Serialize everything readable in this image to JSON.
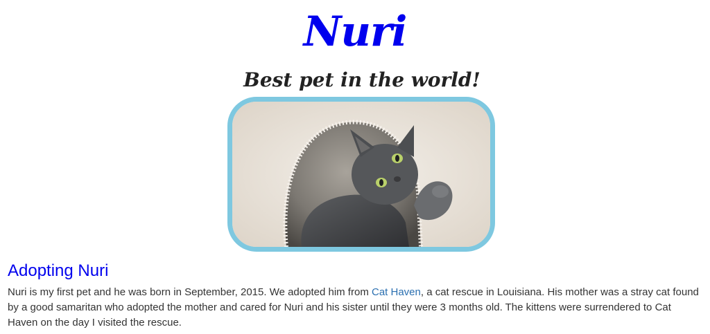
{
  "header": {
    "title": "Nuri",
    "subtitle": "Best pet in the world!"
  },
  "photo": {
    "icon": "cat-photo",
    "frame_color": "#7ec8e0"
  },
  "adoption": {
    "heading": "Adopting Nuri",
    "text_before_link": "Nuri is my first pet and he was born in September, 2015. We adopted him from ",
    "link_text": "Cat Haven",
    "text_after_link": ", a cat rescue in Louisiana. His mother was a stray cat found by a good samaritan who adopted the mother and cared for Nuri and his sister until they were 3 months old. The kittens were surrendered to Cat Haven on the day I visited the rescue."
  },
  "colors": {
    "heading_blue": "#0000ee",
    "link_blue": "#2a6fb0",
    "body_text": "#333333"
  }
}
